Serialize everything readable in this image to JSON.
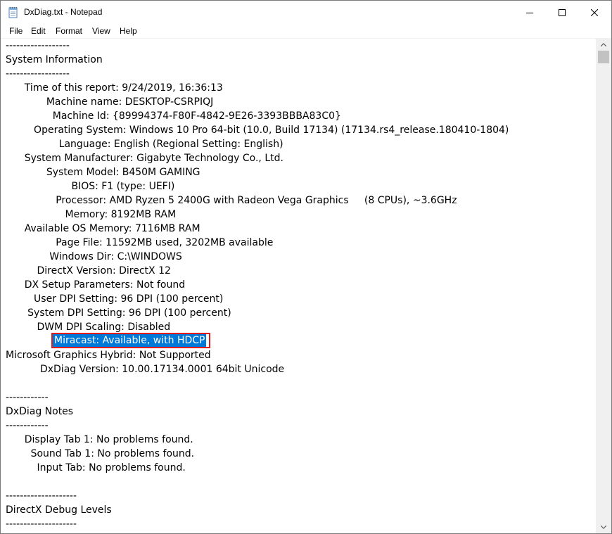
{
  "window": {
    "title": "DxDiag.txt - Notepad",
    "app_icon": "notepad-icon",
    "controls": {
      "minimize_icon": "minimize-icon",
      "maximize_icon": "maximize-icon",
      "close_icon": "close-icon"
    }
  },
  "menu": {
    "file": "File",
    "edit": "Edit",
    "format": "Format",
    "view": "View",
    "help": "Help"
  },
  "document": {
    "lines": [
      "------------------",
      "System Information",
      "------------------",
      "      Time of this report: 9/24/2019, 16:36:13",
      "             Machine name: DESKTOP-CSRPIQJ",
      "               Machine Id: {89994374-F80F-4842-9E26-3393BBBA83C0}",
      "         Operating System: Windows 10 Pro 64-bit (10.0, Build 17134) (17134.rs4_release.180410-1804)",
      "                 Language: English (Regional Setting: English)",
      "      System Manufacturer: Gigabyte Technology Co., Ltd.",
      "             System Model: B450M GAMING",
      "                     BIOS: F1 (type: UEFI)",
      "                Processor: AMD Ryzen 5 2400G with Radeon Vega Graphics     (8 CPUs), ~3.6GHz",
      "                   Memory: 8192MB RAM",
      "      Available OS Memory: 7116MB RAM",
      "                Page File: 11592MB used, 3202MB available",
      "              Windows Dir: C:\\WINDOWS",
      "          DirectX Version: DirectX 12",
      "      DX Setup Parameters: Not found",
      "         User DPI Setting: 96 DPI (100 percent)",
      "       System DPI Setting: 96 DPI (100 percent)",
      "          DWM DPI Scaling: Disabled",
      "",
      "Microsoft Graphics Hybrid: Not Supported",
      "           DxDiag Version: 10.00.17134.0001 64bit Unicode",
      "",
      "------------",
      "DxDiag Notes",
      "------------",
      "      Display Tab 1: No problems found.",
      "        Sound Tab 1: No problems found.",
      "          Input Tab: No problems found.",
      "",
      "--------------------",
      "DirectX Debug Levels",
      "--------------------"
    ],
    "selected_text": "Miracast: Available, with HDCP",
    "selection_color": "#0078d7",
    "annotation_color": "#e01b1b"
  },
  "scrollbar": {
    "up_icon": "scroll-up-arrow-icon",
    "down_icon": "scroll-down-arrow-icon"
  }
}
